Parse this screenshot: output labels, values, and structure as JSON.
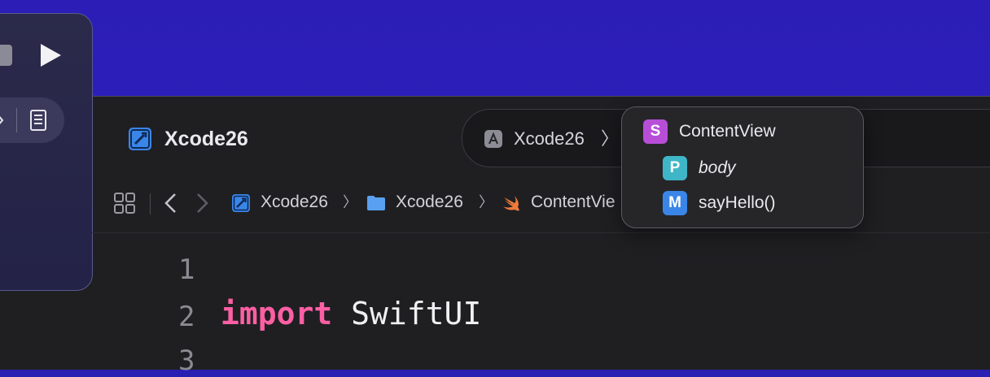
{
  "window": {
    "project_title": "Xcode26"
  },
  "scheme": {
    "label": "Xcode26",
    "chevron": "〉"
  },
  "jumpbar": {
    "items": [
      {
        "label": "Xcode26",
        "icon": "xcode-project-icon"
      },
      {
        "label": "Xcode26",
        "icon": "folder-icon"
      },
      {
        "label": "ContentVie",
        "icon": "swift-icon"
      }
    ],
    "chevron": "〉"
  },
  "popup": {
    "items": [
      {
        "badge": "S",
        "label": "ContentView",
        "color": "#b84ed8"
      },
      {
        "badge": "P",
        "label": "body",
        "color": "#3fb6c8"
      },
      {
        "badge": "M",
        "label": "sayHello()",
        "color": "#3a86e8"
      }
    ]
  },
  "editor": {
    "line_numbers": [
      "1",
      "2",
      "3"
    ],
    "line2_keyword": "import",
    "line2_module": "SwiftUI"
  },
  "colors": {
    "desktop": "#2b1db6",
    "keyword": "#fc5fa3",
    "project_icon": "#3a86e8"
  }
}
